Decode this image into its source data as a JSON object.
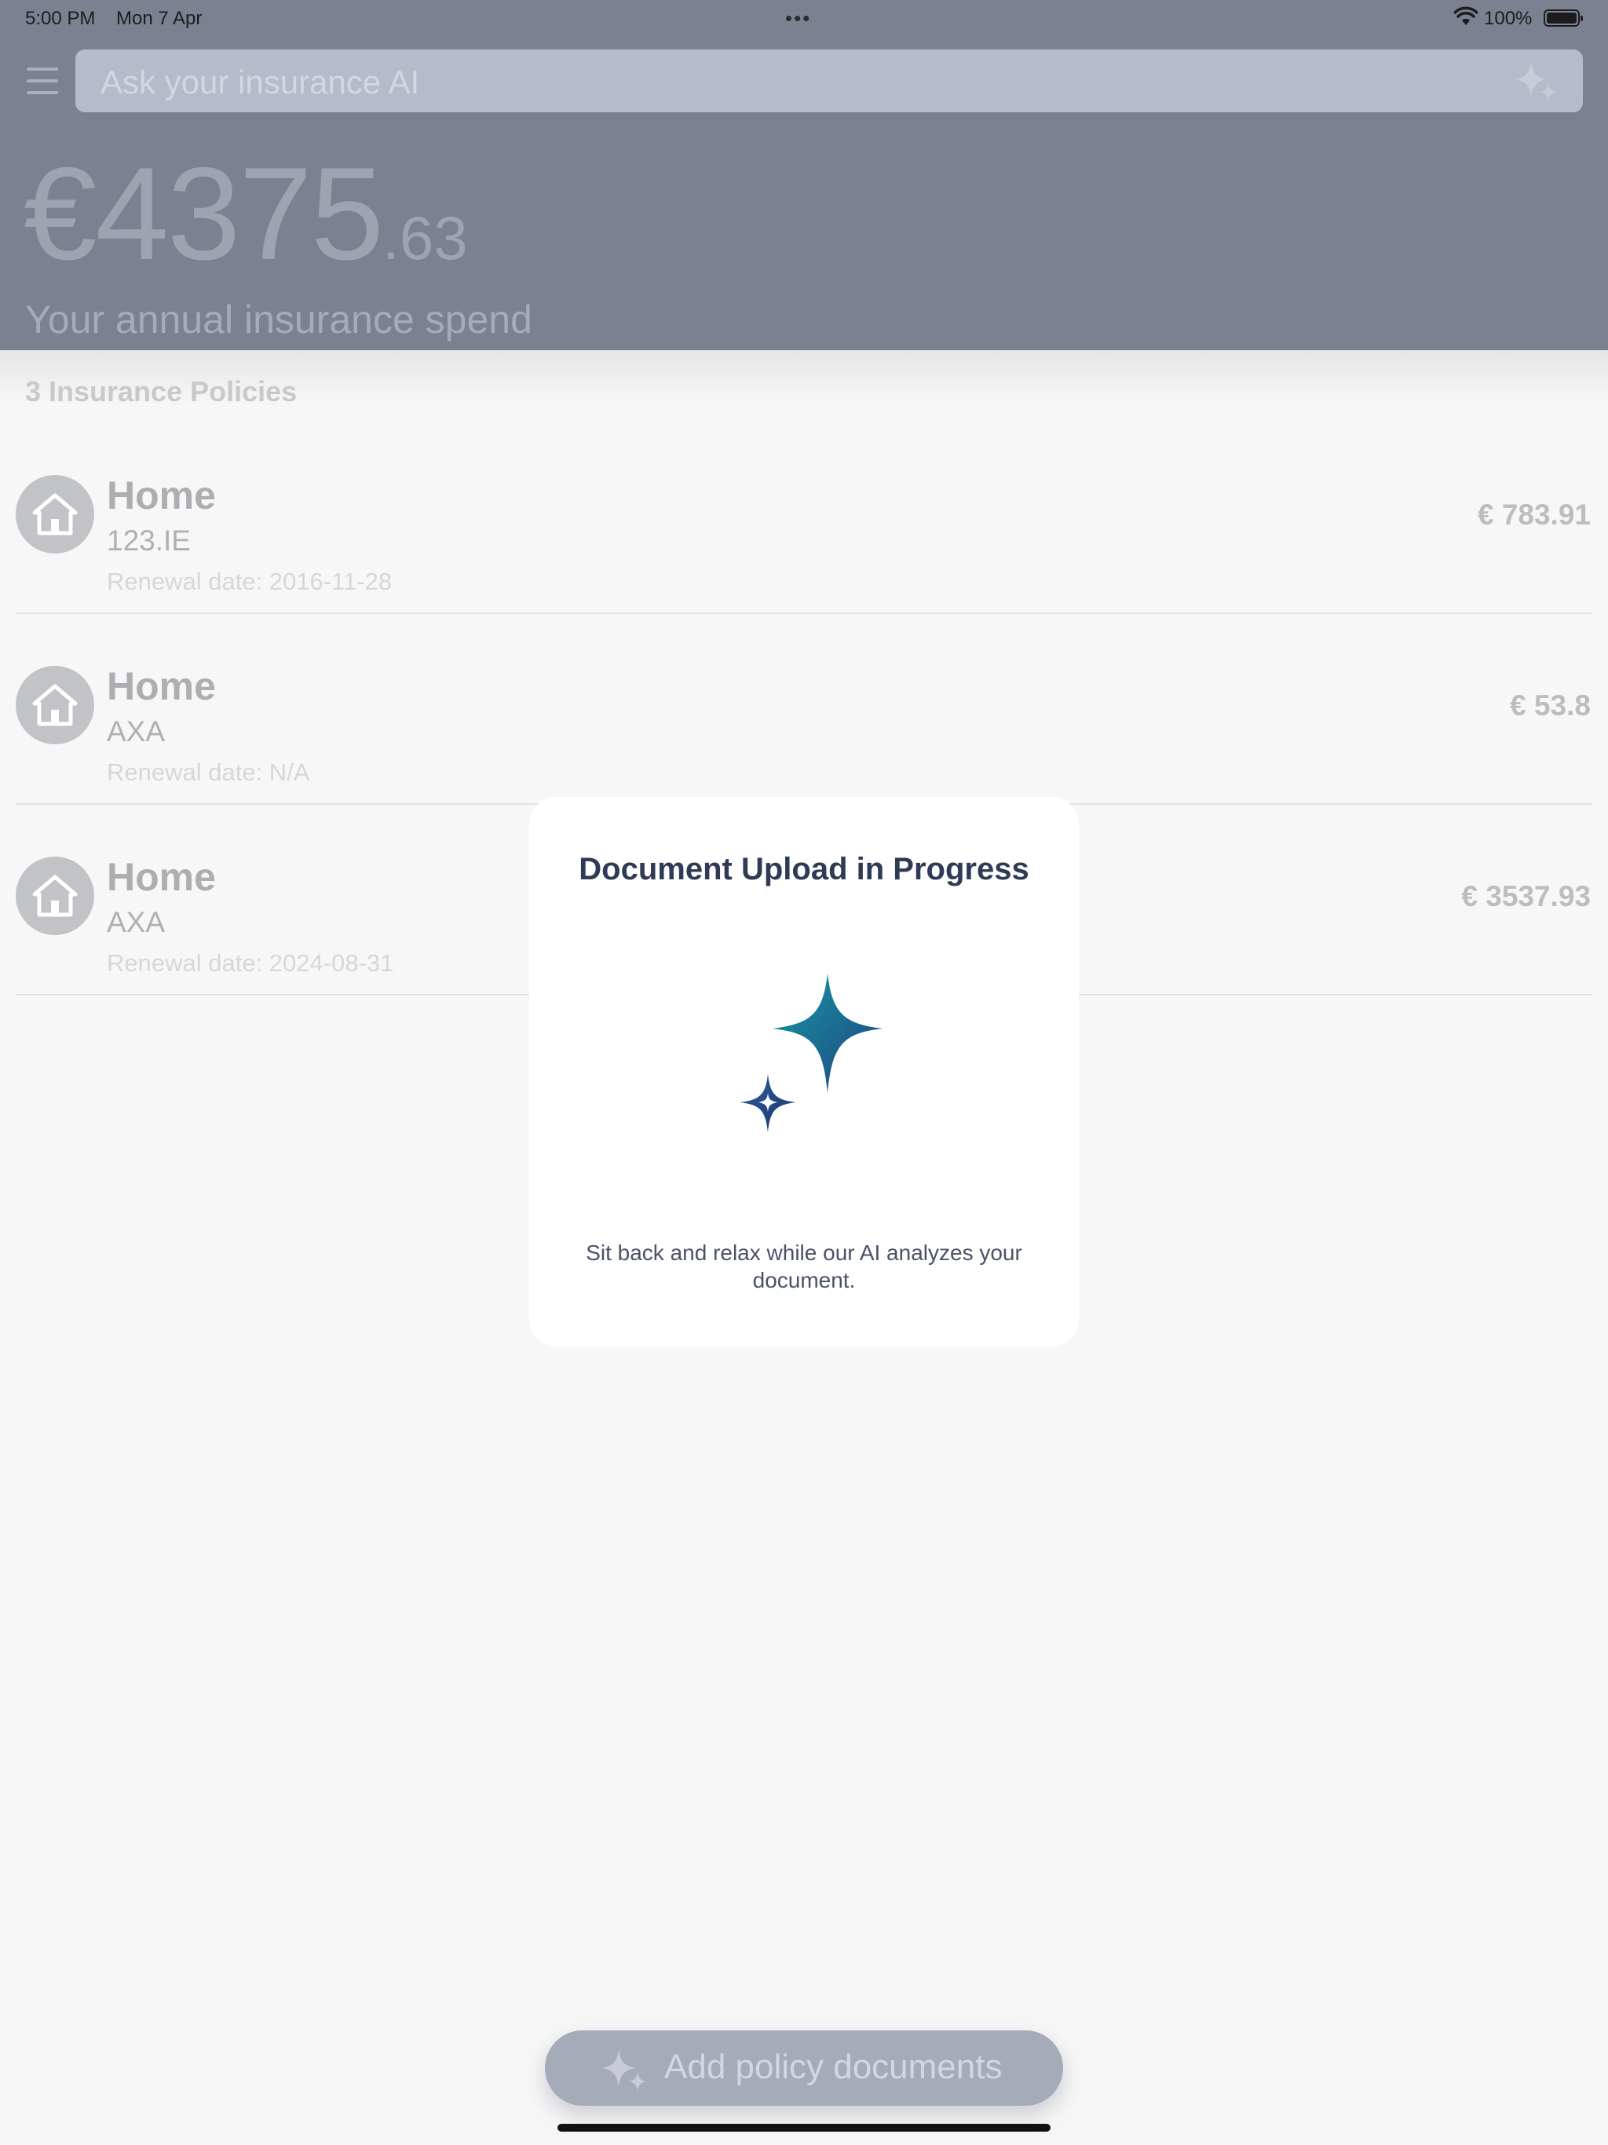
{
  "status_bar": {
    "time": "5:00 PM",
    "date": "Mon 7 Apr",
    "dots": "•••",
    "battery_percent": "100%"
  },
  "search": {
    "placeholder": "Ask your insurance AI"
  },
  "summary": {
    "amount_major": "€4375",
    "amount_minor": ".63",
    "label": "Your annual insurance spend"
  },
  "policies_count_label": "3 Insurance Policies",
  "policies": [
    {
      "type": "Home",
      "provider": "123.IE",
      "renewal": "Renewal date: 2016-11-28",
      "price": "€  783.91"
    },
    {
      "type": "Home",
      "provider": "AXA",
      "renewal": "Renewal date: N/A",
      "price": "€  53.8"
    },
    {
      "type": "Home",
      "provider": "AXA",
      "renewal": "Renewal date: 2024-08-31",
      "price": "€  3537.93"
    }
  ],
  "modal": {
    "title": "Document Upload in Progress",
    "message": "Sit back and relax while our AI analyzes your document."
  },
  "add_button": {
    "label": "Add policy documents"
  },
  "colors": {
    "header_bg": "#7c8191",
    "modal_title": "#2f3b55",
    "sparkle_teal": "#1a8a9a",
    "sparkle_navy": "#203d7a"
  },
  "icons": [
    "menu-icon",
    "sparkle-icon",
    "home-icon",
    "wifi-icon",
    "battery-icon"
  ]
}
